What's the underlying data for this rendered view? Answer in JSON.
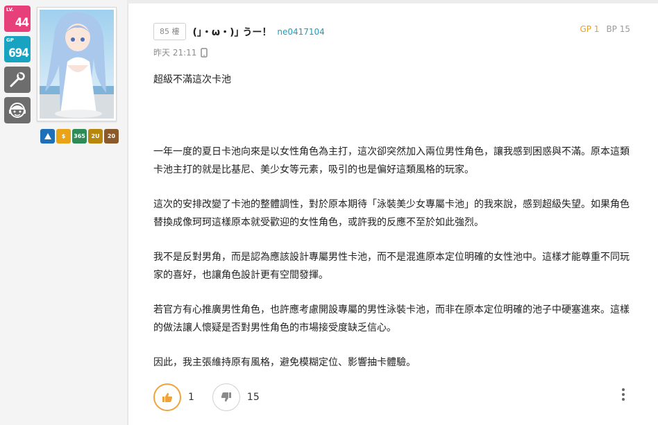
{
  "sidebar": {
    "level_label": "LV.",
    "level_value": "44",
    "gp_label": "GP",
    "gp_value": "694"
  },
  "medals": [
    {
      "text": "",
      "color": "#1d6fb8"
    },
    {
      "text": "$",
      "color": "#e8a317"
    },
    {
      "text": "365",
      "color": "#2e8b57"
    },
    {
      "text": "2U",
      "color": "#b8860b"
    },
    {
      "text": "20",
      "color": "#8b5a2b"
    }
  ],
  "post": {
    "floor": "85 樓",
    "username": "(｣・ω・)｣ うー！",
    "user_id": "ne0417104",
    "time": "昨天 21:11",
    "gp": "GP 1",
    "bp": "BP 15",
    "title_line": "超級不滿這次卡池",
    "paragraphs": [
      "一年一度的夏日卡池向來是以女性角色為主打，這次卻突然加入兩位男性角色，讓我感到困惑與不滿。原本這類卡池主打的就是比基尼、美少女等元素，吸引的也是偏好這類風格的玩家。",
      "這次的安排改變了卡池的整體調性，對於原本期待「泳裝美少女專屬卡池」的我來說，感到超級失望。如果角色替換成像珂珂這樣原本就受歡迎的女性角色，或許我的反應不至於如此強烈。",
      "我不是反對男角，而是認為應該設計專屬男性卡池，而不是混進原本定位明確的女性池中。這樣才能尊重不同玩家的喜好，也讓角色設計更有空間發揮。",
      "若官方有心推廣男性角色，也許應考慮開設專屬的男性泳裝卡池，而非在原本定位明確的池子中硬塞進來。這樣的做法讓人懷疑是否對男性角色的市場接受度缺乏信心。",
      "因此，我主張維持原有風格，避免模糊定位、影響抽卡體驗。"
    ],
    "like_count": "1",
    "dislike_count": "15"
  },
  "colors": {
    "level_badge": "#e63f7a",
    "gp_badge": "#1aa3c0",
    "gp_text": "#e8a317",
    "user_id": "#1b9dbb",
    "like_ring": "#f0a33a"
  }
}
